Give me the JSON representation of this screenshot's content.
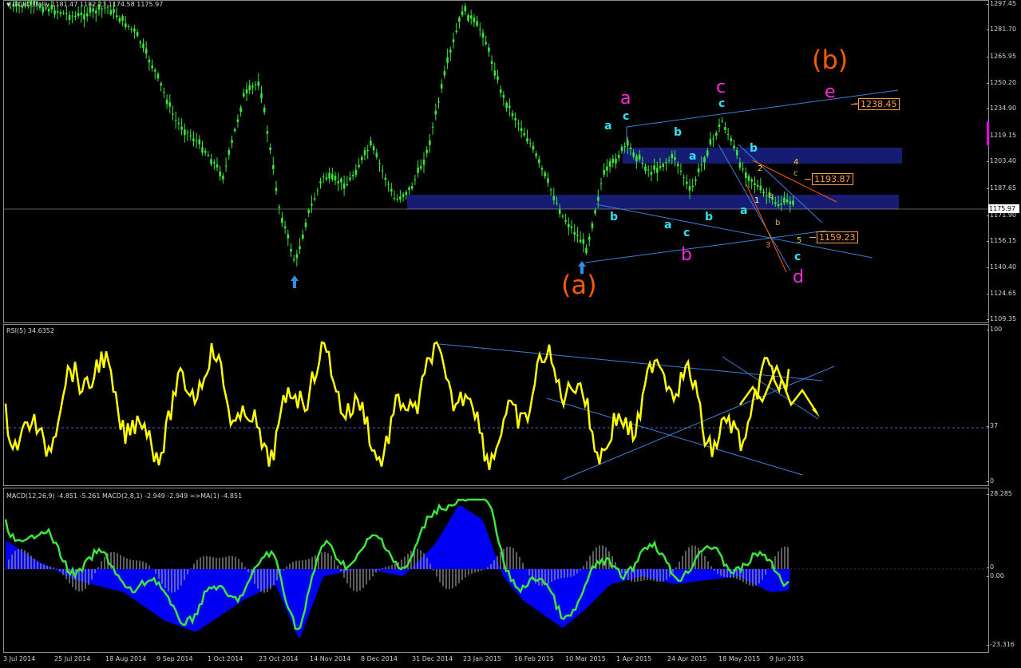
{
  "main_panel": {
    "symbol_header": "GOLD,Daily  1181.47 1182.23 1174.58 1175.97",
    "price_ticks": [
      "1297.45",
      "1281.70",
      "1265.95",
      "1250.20",
      "1234.90",
      "1219.15",
      "1203.40",
      "1187.65",
      "1171.90",
      "1156.15",
      "1140.40",
      "1124.65",
      "1109.35"
    ],
    "current_price": "1175.97",
    "price_boxes": [
      "1238.45",
      "1193.87",
      "1159.23"
    ],
    "wave_labels": {
      "big_a": "(a)",
      "big_b": "(b)",
      "mag_a": "a",
      "mag_b": "b",
      "mag_c": "c",
      "mag_d": "d",
      "mag_e": "e",
      "cyan": [
        "a",
        "c",
        "b",
        "b",
        "a",
        "a",
        "c",
        "b",
        "c",
        "b",
        "a",
        "c",
        "c",
        "b",
        "b",
        "a"
      ],
      "small": [
        "1",
        "2",
        "3",
        "4",
        "5",
        "a",
        "b",
        "c"
      ]
    },
    "colors": {
      "candles": "#39e639",
      "zones": "#1a1f80",
      "trendlines": "#3b7fd9",
      "orange": "#ff5a00",
      "magenta": "#ff2bd8",
      "cyan": "#31e1f2"
    }
  },
  "rsi_panel": {
    "header": "RSI(5) 34.6352",
    "ticks": [
      "100",
      "37",
      "0"
    ],
    "line_color": "#ffff00"
  },
  "macd_panel": {
    "header": "MACD(12,26,9) -4.851 -5.261  MACD(2,8,1) -2.949 -2.949  =>MA(1) -4.851",
    "ticks": [
      "28.285",
      "0",
      "0.00",
      "-23.316"
    ],
    "colors": {
      "area": "#0000ff",
      "signal": "#3ce63c",
      "hist": "#9c9c9c"
    }
  },
  "date_axis": [
    "3 Jul 2014",
    "25 Jul 2014",
    "18 Aug 2014",
    "9 Sep 2014",
    "1 Oct 2014",
    "23 Oct 2014",
    "14 Nov 2014",
    "8 Dec 2014",
    "31 Dec 2014",
    "23 Jan 2015",
    "16 Feb 2015",
    "10 Mar 2015",
    "1 Apr 2015",
    "24 Apr 2015",
    "18 May 2015",
    "9 Jun 2015"
  ]
}
